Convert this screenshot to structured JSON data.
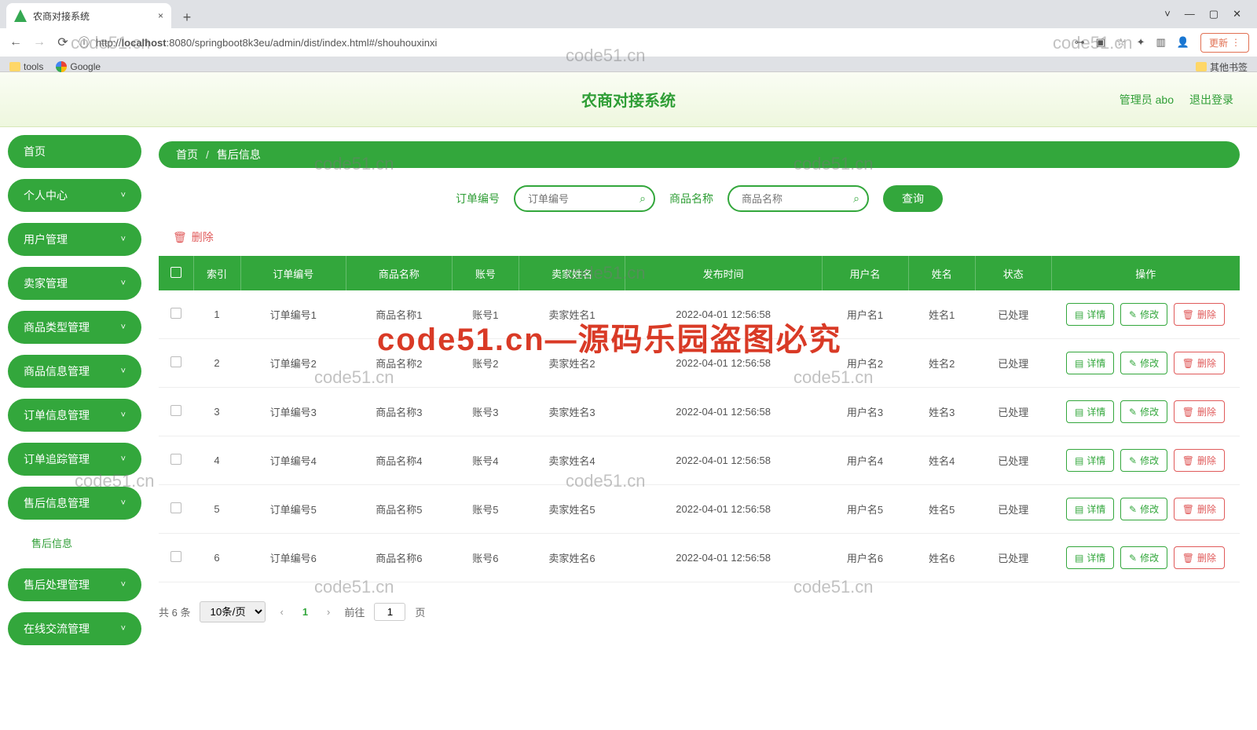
{
  "browser": {
    "tab_title": "农商对接系统",
    "url_host": "localhost",
    "url_rest": ":8080/springboot8k3eu/admin/dist/index.html#/shouhouxinxi",
    "url_proto": "http://",
    "update_label": "更新",
    "bookmarks": {
      "tools": "tools",
      "google": "Google",
      "other": "其他书签"
    }
  },
  "header": {
    "title": "农商对接系统",
    "admin": "管理员 abo",
    "logout": "退出登录"
  },
  "sidebar": {
    "items": [
      {
        "label": "首页",
        "expandable": false
      },
      {
        "label": "个人中心",
        "expandable": true
      },
      {
        "label": "用户管理",
        "expandable": true
      },
      {
        "label": "卖家管理",
        "expandable": true
      },
      {
        "label": "商品类型管理",
        "expandable": true
      },
      {
        "label": "商品信息管理",
        "expandable": true
      },
      {
        "label": "订单信息管理",
        "expandable": true
      },
      {
        "label": "订单追踪管理",
        "expandable": true
      },
      {
        "label": "售后信息管理",
        "expandable": true,
        "expanded": true,
        "sub": "售后信息"
      },
      {
        "label": "售后处理管理",
        "expandable": true
      },
      {
        "label": "在线交流管理",
        "expandable": true
      }
    ]
  },
  "breadcrumb": {
    "home": "首页",
    "current": "售后信息"
  },
  "filters": {
    "order_label": "订单编号",
    "order_placeholder": "订单编号",
    "product_label": "商品名称",
    "product_placeholder": "商品名称",
    "query": "查询"
  },
  "bulk_delete": "删除",
  "columns": [
    "",
    "索引",
    "订单编号",
    "商品名称",
    "账号",
    "卖家姓名",
    "发布时间",
    "用户名",
    "姓名",
    "状态",
    "操作"
  ],
  "action_labels": {
    "detail": "详情",
    "edit": "修改",
    "delete": "删除"
  },
  "rows": [
    {
      "idx": "1",
      "order": "订单编号1",
      "product": "商品名称1",
      "account": "账号1",
      "seller": "卖家姓名1",
      "time": "2022-04-01 12:56:58",
      "user": "用户名1",
      "name": "姓名1",
      "status": "已处理"
    },
    {
      "idx": "2",
      "order": "订单编号2",
      "product": "商品名称2",
      "account": "账号2",
      "seller": "卖家姓名2",
      "time": "2022-04-01 12:56:58",
      "user": "用户名2",
      "name": "姓名2",
      "status": "已处理"
    },
    {
      "idx": "3",
      "order": "订单编号3",
      "product": "商品名称3",
      "account": "账号3",
      "seller": "卖家姓名3",
      "time": "2022-04-01 12:56:58",
      "user": "用户名3",
      "name": "姓名3",
      "status": "已处理"
    },
    {
      "idx": "4",
      "order": "订单编号4",
      "product": "商品名称4",
      "account": "账号4",
      "seller": "卖家姓名4",
      "time": "2022-04-01 12:56:58",
      "user": "用户名4",
      "name": "姓名4",
      "status": "已处理"
    },
    {
      "idx": "5",
      "order": "订单编号5",
      "product": "商品名称5",
      "account": "账号5",
      "seller": "卖家姓名5",
      "time": "2022-04-01 12:56:58",
      "user": "用户名5",
      "name": "姓名5",
      "status": "已处理"
    },
    {
      "idx": "6",
      "order": "订单编号6",
      "product": "商品名称6",
      "account": "账号6",
      "seller": "卖家姓名6",
      "time": "2022-04-01 12:56:58",
      "user": "用户名6",
      "name": "姓名6",
      "status": "已处理"
    }
  ],
  "pagination": {
    "total_text": "共 6 条",
    "page_size": "10条/页",
    "current": "1",
    "goto_label": "前往",
    "goto_value": "1",
    "page_suffix": "页"
  },
  "watermarks": {
    "small": "code51.cn",
    "big": "code51.cn—源码乐园盗图必究"
  }
}
